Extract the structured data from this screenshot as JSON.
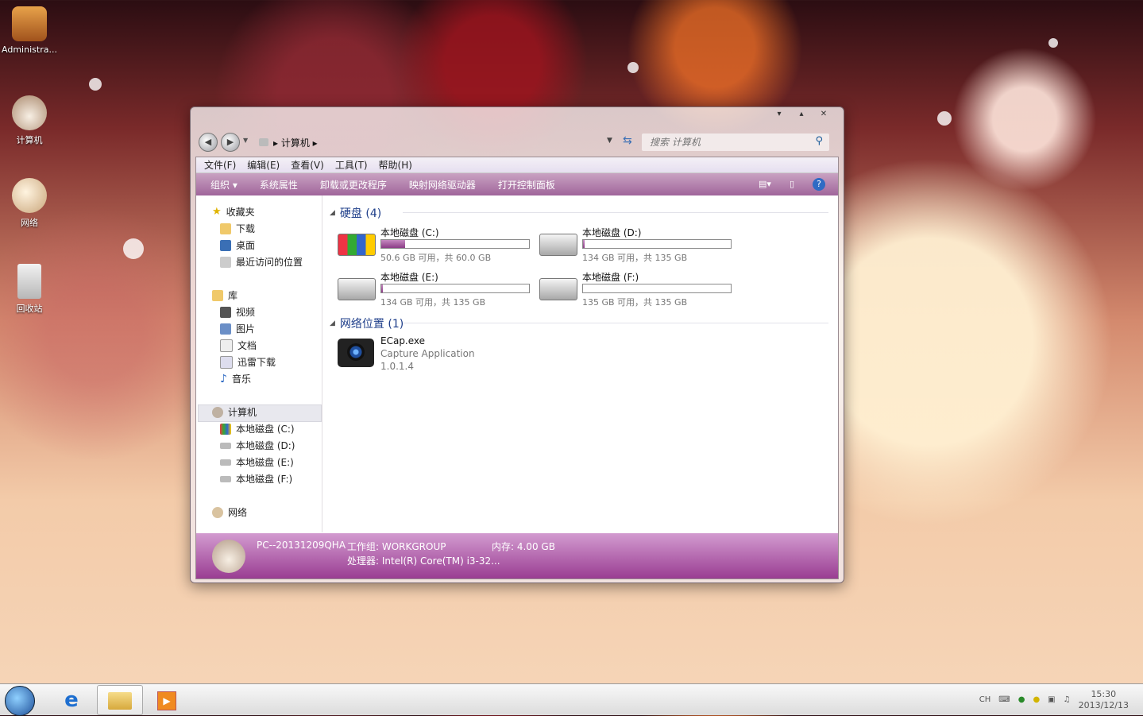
{
  "desktop": {
    "icons": [
      {
        "label": "Administra..."
      },
      {
        "label": "计算机"
      },
      {
        "label": "网络"
      },
      {
        "label": "回收站"
      }
    ]
  },
  "window": {
    "address": {
      "crumb": "计算机",
      "search_placeholder": "搜索 计算机"
    },
    "menu": [
      "文件(F)",
      "编辑(E)",
      "查看(V)",
      "工具(T)",
      "帮助(H)"
    ],
    "toolbar": [
      "组织 ▾",
      "系统属性",
      "卸载或更改程序",
      "映射网络驱动器",
      "打开控制面板"
    ],
    "nav": {
      "favorites": "收藏夹",
      "favorites_items": [
        "下载",
        "桌面",
        "最近访问的位置"
      ],
      "libraries": "库",
      "libraries_items": [
        "视频",
        "图片",
        "文档",
        "迅雷下载",
        "音乐"
      ],
      "computer": "计算机",
      "computer_items": [
        "本地磁盘 (C:)",
        "本地磁盘 (D:)",
        "本地磁盘 (E:)",
        "本地磁盘 (F:)"
      ],
      "network": "网络"
    },
    "sections": {
      "hard_disks": "硬盘 (4)",
      "network": "网络位置 (1)"
    },
    "drives": [
      {
        "name": "本地磁盘 (C:)",
        "info": "50.6 GB 可用，共 60.0 GB",
        "used_fraction": 0.16
      },
      {
        "name": "本地磁盘 (D:)",
        "info": "134 GB 可用，共 135 GB",
        "used_fraction": 0.01
      },
      {
        "name": "本地磁盘 (E:)",
        "info": "134 GB 可用，共 135 GB",
        "used_fraction": 0.01
      },
      {
        "name": "本地磁盘 (F:)",
        "info": "135 GB 可用，共 135 GB",
        "used_fraction": 0.0
      }
    ],
    "network_item": {
      "name": "ECap.exe",
      "desc": "Capture Application",
      "version": "1.0.1.4"
    },
    "details": {
      "pc": "PC--20131209QHA",
      "workgroup": "工作组: WORKGROUP",
      "memory": "内存: 4.00 GB",
      "cpu": "处理器: Intel(R) Core(TM) i3-32..."
    }
  },
  "taskbar": {
    "lang": "CH",
    "time": "15:30",
    "date": "2013/12/13"
  },
  "colors": {
    "accent": "#a0659b",
    "link": "#1e3e8a"
  }
}
